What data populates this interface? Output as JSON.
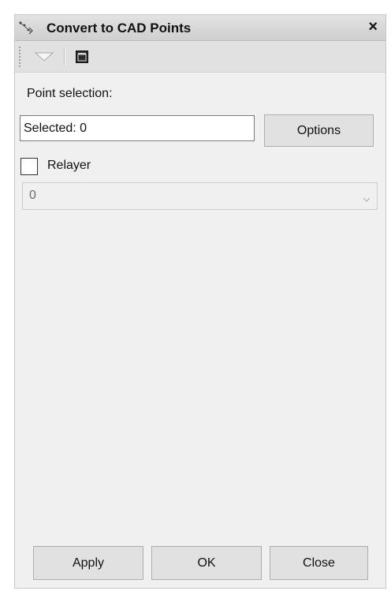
{
  "window": {
    "title": "Convert to CAD Points",
    "close_glyph": "×"
  },
  "icons": {
    "title": "convert-points-icon",
    "close": "close-icon",
    "toolbar_dropdown": "chevron-down-icon",
    "toolbar_window": "window-icon",
    "select_arrow": "chevron-down-icon"
  },
  "form": {
    "point_selection_label": "Point selection:",
    "selected_value": "Selected: 0",
    "options_label": "Options",
    "relayer_label": "Relayer",
    "relayer_checked": false,
    "layer_value": "0"
  },
  "footer": {
    "apply_label": "Apply",
    "ok_label": "OK",
    "close_label": "Close"
  },
  "colors": {
    "panel_bg": "#f0f0f0",
    "button_bg": "#e1e1e1",
    "disabled_text": "#6d6d6d"
  }
}
